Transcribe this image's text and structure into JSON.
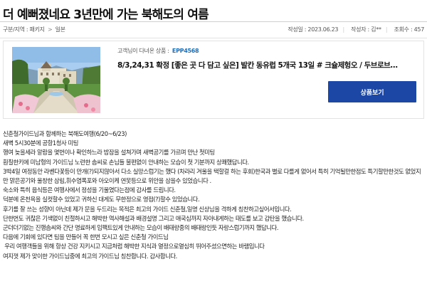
{
  "title": "더 예뻐졌네요 3년만에 가는 북해도의 여름",
  "meta": {
    "category_label": "구분/지역 : 패키지",
    "category_sep": ">",
    "region": "일본",
    "date_label": "작성일 : 2023.06.23",
    "author_label": "작성자 : 김**",
    "views_label": "조회수 : 457"
  },
  "product": {
    "label_prefix": "고객님이 다녀온 상품 :",
    "code": "EPP4568",
    "name": "8/3,24,31 확정 [좋은 곳 다 담고 싶은] 발칸 동유럽 5개국 13일 # 크슐제헝오 / 두브로브...",
    "button_label": "상품보기"
  },
  "review_lines": [
    "신춘철가이드님과 함께하는 북해도여행(6/20~6/23)",
    "새벽 5시30분에 공항1청사 미팅",
    "행여 늦을세라 알람을 몇번이나 확인하느라 밤잠을 설쳐가며 새벽공기를 가르며 만난 첫미팅",
    "훤칠한키에 미남형의 가이드님 노련한 솜씨로 손님들 불편없이 안내하는 모습이 첫 기분까지 상쾌했답니다.",
    "3박4일 여정동안 라벤다꽃등이 만개(?)되지않아서 다소 실망스럽기는 했다 (차라리 겨울을 택할걸 하는 후회)한국과 별로 다를게 없어서 특히 기억될만한점도 특기할만한것도 없었지만 맑은공기와 울창한 삼림,휘수염폭포와 아오이케 연못등으로 위안을 삼을수 있었습니다 .",
    "숙소와 특히 음식등은 여행사에서 정성을 기울였다는점에 감사를 드립니다.",
    "덕분에 온천욕을 실컷할수 있었고 귀하신 대게도 무한정으로 영접(?)할수 있었습니다.",
    "후기를 잘 쓰는 성향이 아닌데 제가 문을 두드리는 목적은 최고의 가이드 신춘철,일명 신상님을 격하게 칭찬하고싶어서입니다.",
    "단한번도 귀찮은 기색없이 친절하시고 해박한 역사해설과 배경설명 그리고 애국심까지 자아내게하는 태도를 보고 감탄을 했습니다.",
    "군더더기없는 진행솜씨와 간단 명료하게 임팩트있게 안내하는 모습이 배태랑중의 배태랑인듯 자랑스럽기까지 했답니다.",
    "다음에 기회에 있다면 팀을 만들어 꼭 한번 모시고 싶은 신춘철 가이드님",
    " 우리 여행객들을 위해 항상 건강 지키시고 지금처럼 해박한 지식과 열정으로열심히 뛰어주셨으면하는 바램입니다",
    "여지껏 제가 맞이한 가이드님중에 최고의 가이드님 칭찬합니다. 감사합니다."
  ],
  "colors": {
    "accent": "#1d47a5",
    "code": "#1f6fbf"
  }
}
